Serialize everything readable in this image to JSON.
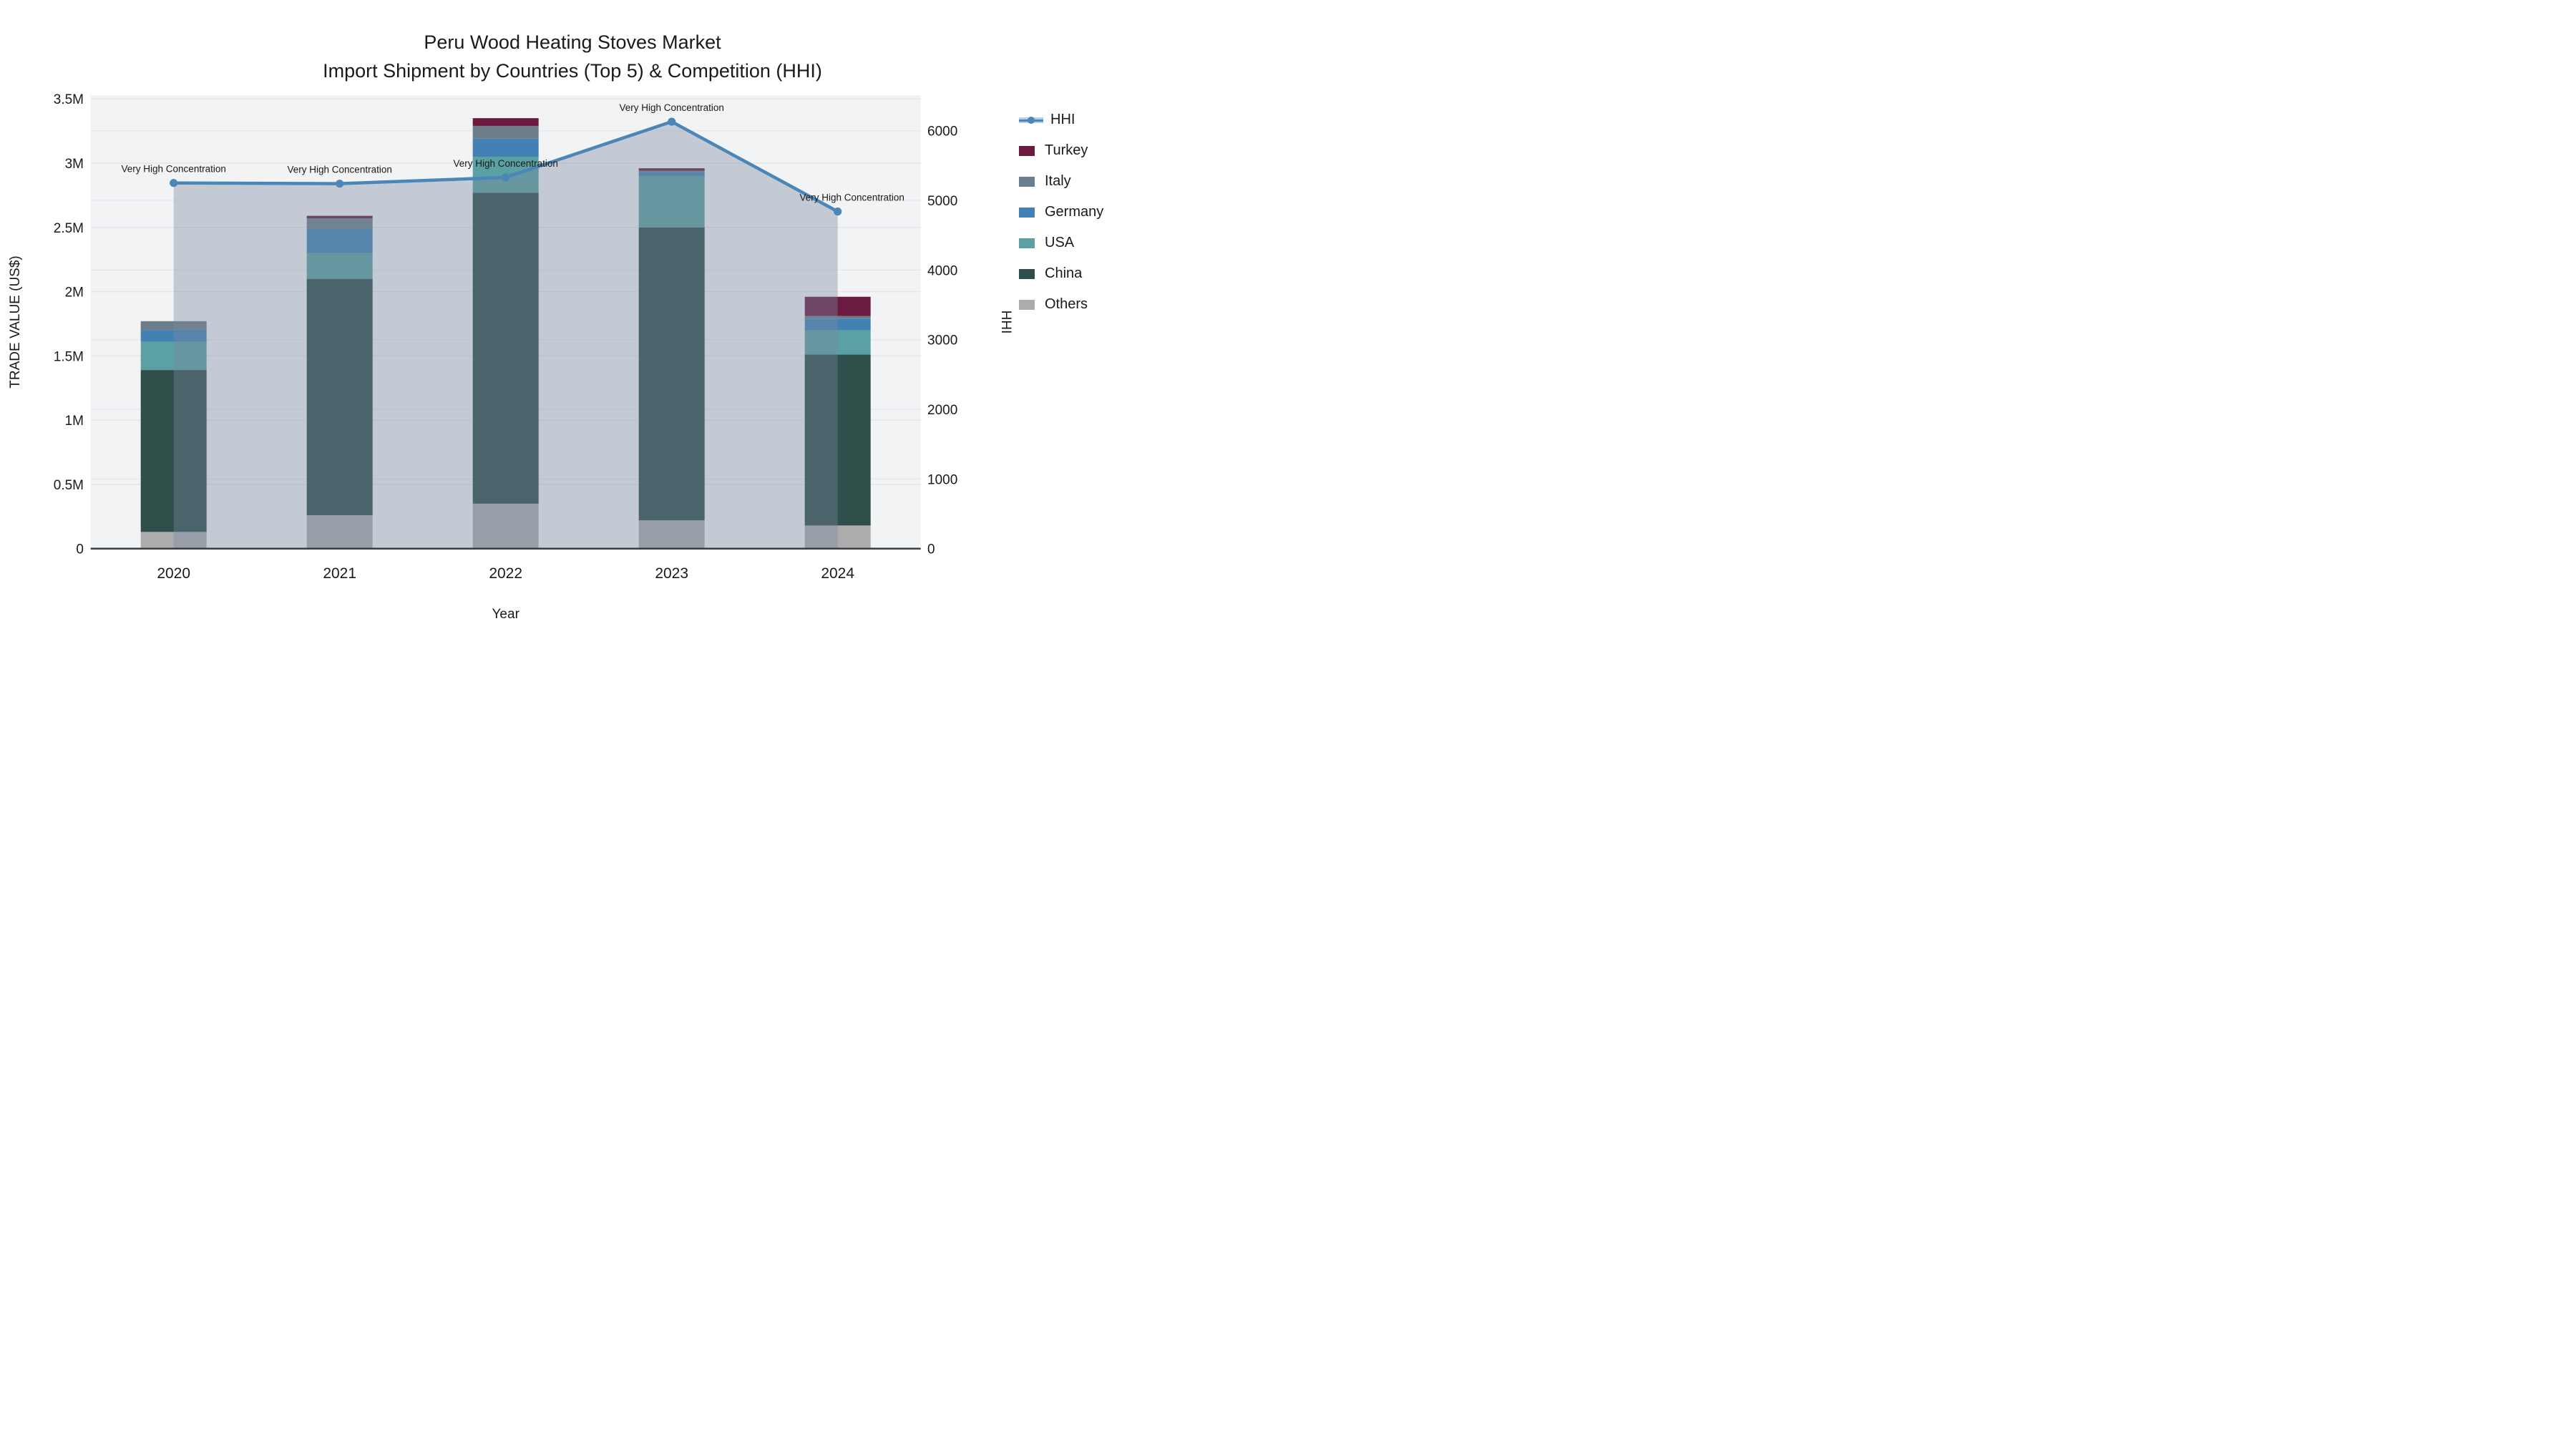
{
  "title": {
    "line1": "Peru Wood Heating Stoves Market",
    "line2": "Import Shipment by Countries (Top 5) & Competition (HHI)"
  },
  "axes": {
    "x_title": "Year",
    "y1_title": "TRADE VALUE (US$)",
    "y2_title": "HHI",
    "y1_ticks": [
      {
        "v": 0,
        "label": "0"
      },
      {
        "v": 0.5,
        "label": "0.5M"
      },
      {
        "v": 1,
        "label": "1M"
      },
      {
        "v": 1.5,
        "label": "1.5M"
      },
      {
        "v": 2,
        "label": "2M"
      },
      {
        "v": 2.5,
        "label": "2.5M"
      },
      {
        "v": 3,
        "label": "3M"
      },
      {
        "v": 3.5,
        "label": "3.5M"
      }
    ],
    "y2_ticks": [
      {
        "v": 0,
        "label": "0"
      },
      {
        "v": 1000,
        "label": "1000"
      },
      {
        "v": 2000,
        "label": "2000"
      },
      {
        "v": 3000,
        "label": "3000"
      },
      {
        "v": 4000,
        "label": "4000"
      },
      {
        "v": 5000,
        "label": "5000"
      },
      {
        "v": 6000,
        "label": "6000"
      }
    ],
    "y1_range": [
      0,
      3.5
    ],
    "y2_range": [
      0,
      6000
    ]
  },
  "chart_data": {
    "type": "bar",
    "subtype": "stacked-bars-with-line",
    "categories": [
      "2020",
      "2021",
      "2022",
      "2023",
      "2024"
    ],
    "stack_order_bottom_to_top": [
      "Others",
      "China",
      "USA",
      "Germany",
      "Italy",
      "Turkey"
    ],
    "series": [
      {
        "name": "Others",
        "values": [
          0.13,
          0.26,
          0.35,
          0.22,
          0.18
        ]
      },
      {
        "name": "China",
        "values": [
          1.26,
          1.84,
          2.42,
          2.28,
          1.33
        ]
      },
      {
        "name": "USA",
        "values": [
          0.22,
          0.2,
          0.28,
          0.4,
          0.19
        ]
      },
      {
        "name": "Germany",
        "values": [
          0.09,
          0.19,
          0.14,
          0.03,
          0.09
        ]
      },
      {
        "name": "Italy",
        "values": [
          0.07,
          0.08,
          0.1,
          0.01,
          0.02
        ]
      },
      {
        "name": "Turkey",
        "values": [
          0.0,
          0.02,
          0.06,
          0.02,
          0.15
        ]
      }
    ],
    "bar_totals_M": [
      1.77,
      2.59,
      3.35,
      2.96,
      1.96
    ],
    "hhi": {
      "name": "HHI",
      "values": [
        5250,
        5240,
        5330,
        6130,
        4840
      ],
      "annotations": [
        "Very High Concentration",
        "Very High Concentration",
        "Very High Concentration",
        "Very High Concentration",
        "Very High Concentration"
      ]
    },
    "title": "Peru Wood Heating Stoves Market — Import Shipment by Countries (Top 5) & Competition (HHI)",
    "xlabel": "Year",
    "ylabel": "TRADE VALUE (US$)",
    "y2label": "HHI",
    "ylim": [
      0,
      3.5
    ],
    "y2lim": [
      0,
      6000
    ],
    "grid": true,
    "legend_position": "right"
  },
  "legend": {
    "entries": [
      {
        "label": "HHI",
        "kind": "line"
      },
      {
        "label": "Turkey",
        "kind": "swatch",
        "color_key": "turkey"
      },
      {
        "label": "Italy",
        "kind": "swatch",
        "color_key": "italy"
      },
      {
        "label": "Germany",
        "kind": "swatch",
        "color_key": "germany"
      },
      {
        "label": "USA",
        "kind": "swatch",
        "color_key": "usa"
      },
      {
        "label": "China",
        "kind": "swatch",
        "color_key": "china"
      },
      {
        "label": "Others",
        "kind": "swatch",
        "color_key": "others"
      }
    ]
  },
  "colors": {
    "turkey": "#6B1B3F",
    "italy": "#6C7E8C",
    "germany": "#4381B5",
    "usa": "#5BA0A2",
    "china": "#2F4D49",
    "others": "#ACACAC",
    "hhi_line": "#4A86B8",
    "area_fill": "rgba(122,137,160,0.38)",
    "plot_bg": "#F2F3F4",
    "grid": "#E4E6E9",
    "axis_line": "#3A3F44",
    "legend_hhi_band": "#B8CFE3",
    "text": "#1a1a1a"
  }
}
